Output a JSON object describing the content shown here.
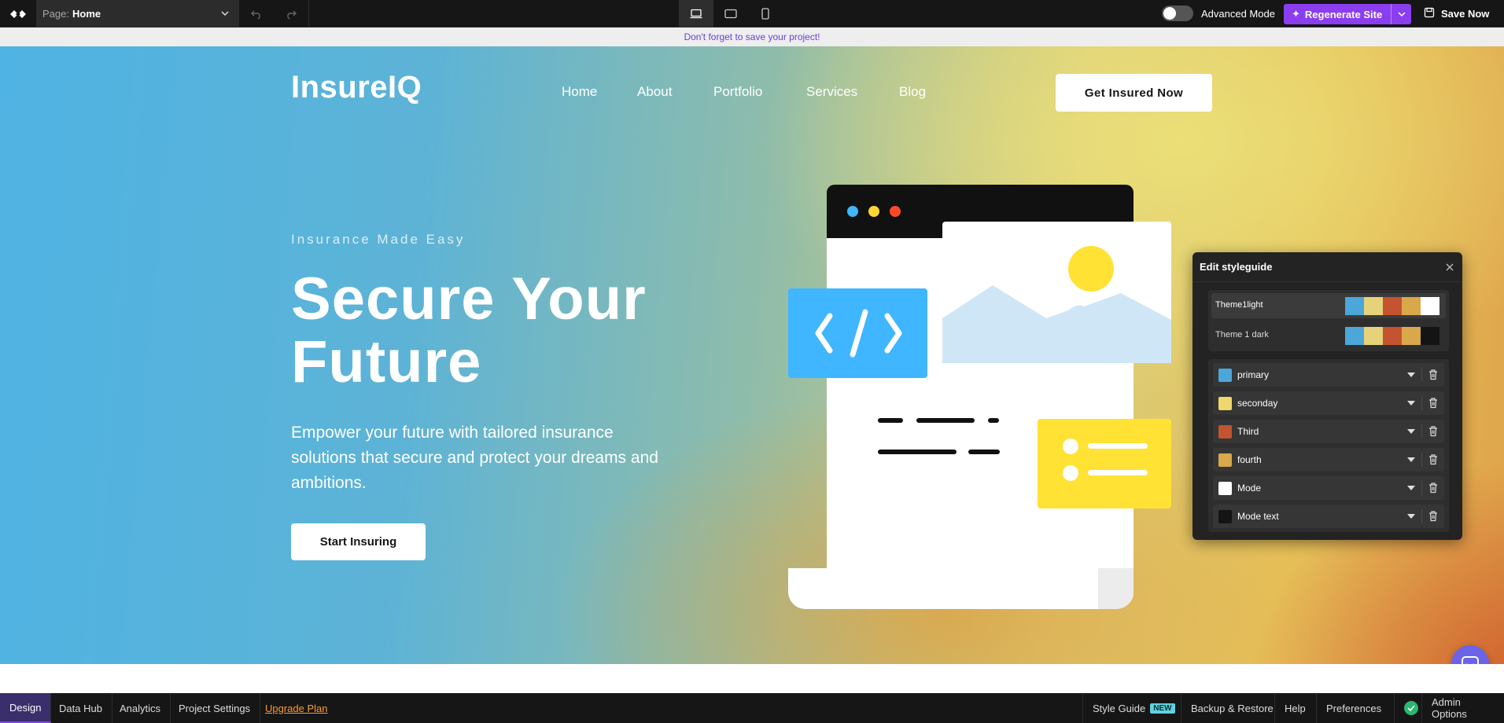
{
  "topbar": {
    "page_label": "Page:",
    "page_value": "Home",
    "advanced_mode_label": "Advanced Mode",
    "advanced_mode_on": false,
    "regenerate_label": "Regenerate Site",
    "save_label": "Save Now"
  },
  "notice": "Don't forget to save your project!",
  "site": {
    "brand": "InsureIQ",
    "nav": [
      "Home",
      "About",
      "Portfolio",
      "Services",
      "Blog"
    ],
    "cta_top": "Get Insured Now",
    "eyebrow": "Insurance Made Easy",
    "headline_1": "Secure Your",
    "headline_2": "Future",
    "subtext": "Empower your future with tailored insurance solutions that secure and protect your dreams and ambitions.",
    "cta_hero": "Start Insuring"
  },
  "styleguide": {
    "title": "Edit styleguide",
    "themes": [
      {
        "name": "Theme1light",
        "colors": [
          "#4ba7d9",
          "#e6d27a",
          "#c4532f",
          "#d9a84a",
          "#ffffff"
        ]
      },
      {
        "name": "Theme 1 dark",
        "colors": [
          "#4ba7d9",
          "#e6d27a",
          "#c4532f",
          "#d9a84a",
          "#141414"
        ]
      }
    ],
    "colors": [
      {
        "name": "primary",
        "hex": "#4ba7d9"
      },
      {
        "name": "seconday",
        "hex": "#eed76c"
      },
      {
        "name": "Third",
        "hex": "#c4532f"
      },
      {
        "name": "fourth",
        "hex": "#d9a84a"
      },
      {
        "name": "Mode",
        "hex": "#ffffff"
      },
      {
        "name": "Mode text",
        "hex": "#141414"
      }
    ]
  },
  "bottombar": {
    "tabs": [
      "Design",
      "Data Hub",
      "Analytics",
      "Project Settings"
    ],
    "upgrade": "Upgrade Plan",
    "style_guide": "Style Guide",
    "new_badge": "NEW",
    "backup": "Backup & Restore",
    "help": "Help",
    "preferences": "Preferences",
    "admin": "Admin Options"
  },
  "colors": {
    "accent": "#8a3ef0",
    "notice_text": "#6b3de0",
    "upgrade": "#ff9a2e",
    "status_ok": "#2bb673"
  }
}
